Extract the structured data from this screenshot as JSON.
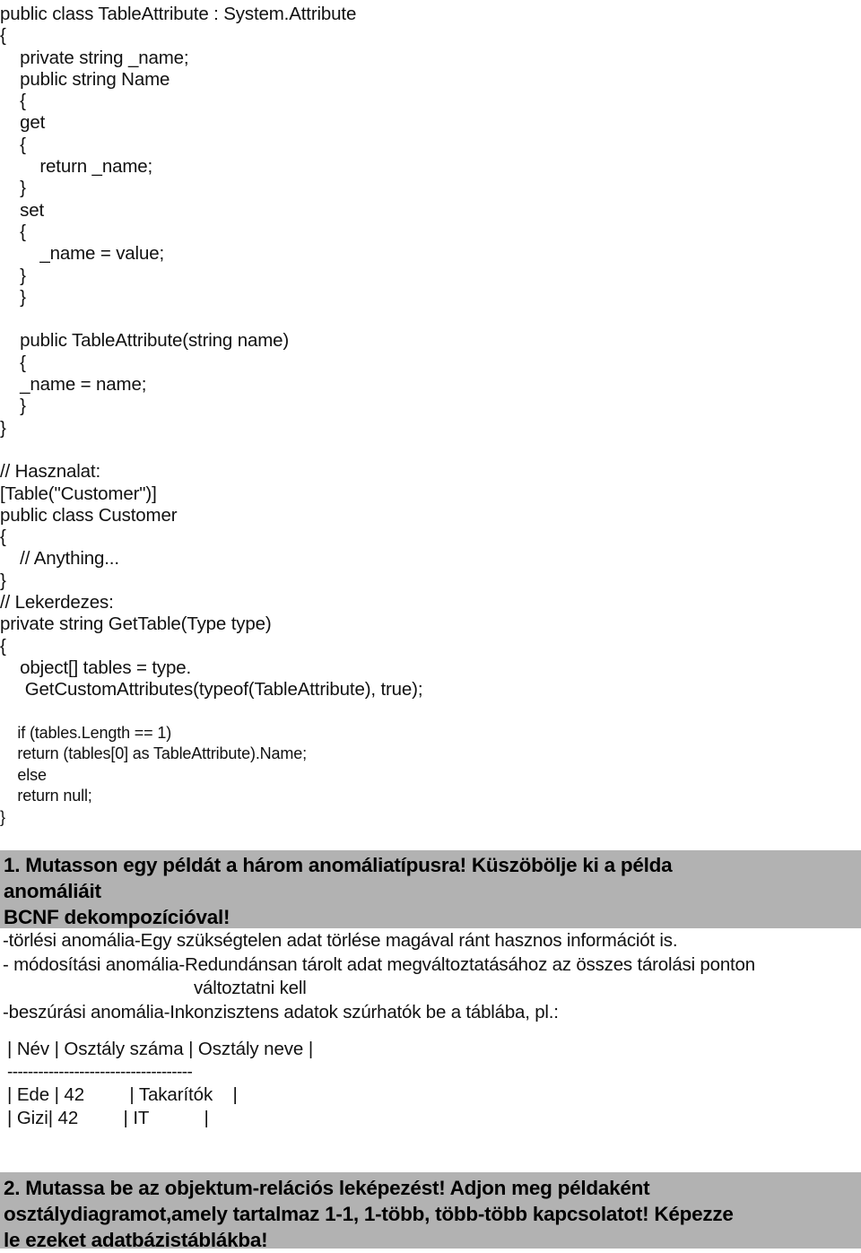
{
  "document": {
    "highlight_color": "#b2b2b2",
    "text_color": "#111111"
  },
  "code": {
    "lines": [
      "public class TableAttribute : System.Attribute",
      "{",
      "    private string _name;",
      "    public string Name",
      "    {",
      "    get",
      "    {",
      "        return _name;",
      "    }",
      "    set",
      "    {",
      "        _name = value;",
      "    }",
      "    }",
      "",
      "    public TableAttribute(string name)",
      "    {",
      "    _name = name;",
      "    }",
      "}",
      "",
      "// Hasznalat:",
      "[Table(\"Customer\")]",
      "public class Customer",
      "{",
      "    // Anything...",
      "}",
      "// Lekerdezes:",
      "private string GetTable(Type type)",
      "{",
      "    object[] tables = type.",
      "     GetCustomAttributes(typeof(TableAttribute), true);",
      "",
      "    if (tables.Length == 1)",
      "    return (tables[0] as TableAttribute).Name;",
      "    else",
      "    return null;",
      "}"
    ]
  },
  "question1": {
    "heading_lines": [
      "1. Mutasson egy példát a három anomáliatípusra! Küszöbölje ki a példa",
      "anomáliáit",
      "BCNF dekompozícióval!"
    ],
    "body_lines": [
      "-törlési anomália-Egy szükségtelen adat törlése magával ránt hasznos információt is.",
      "- módosítási anomália-Redundánsan tárolt adat megváltoztatásához az összes tárolási ponton",
      "változtatni kell",
      "-beszúrási anomália-Inkonzisztens adatok szúrhatók be a táblába, pl.:"
    ],
    "table_lines": [
      "| Név | Osztály száma | Osztály neve |",
      "------------------------------------",
      "| Ede | 42         | Takarítók    |",
      "| Gizi| 42         | IT           |"
    ]
  },
  "question2": {
    "heading_lines": [
      "2. Mutassa be az objektum-relációs leképezést! Adjon meg példaként",
      "osztálydiagramot,amely tartalmaz 1-1, 1-több, több-több kapcsolatot! Képezze",
      "le ezeket adatbázistáblákba!"
    ]
  }
}
